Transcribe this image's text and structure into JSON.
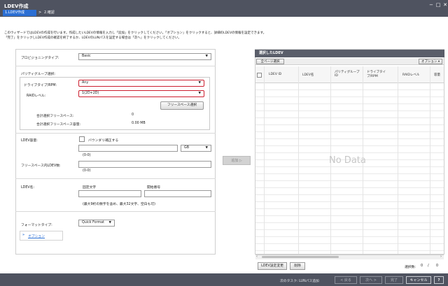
{
  "window": {
    "title": "LDEV作成",
    "minimize_label": "−",
    "maximize_label": "□",
    "close_label": "✕",
    "steps": [
      "1.LDEV作成",
      "2.確認"
    ],
    "step_separator": ">"
  },
  "instructions": {
    "line1": "このウィザードではLDEVの作成を行います。作成したいLDEVの情報を入力し「追加」をクリックしてください。「オプション」をクリックすると、詳細のLDEVの情報を設定できます。",
    "line2": "「完了」をクリックしLDEV作成の確認を終了するか、LDEVのLUNパスを設定する場合は「次へ」をクリックしてください。"
  },
  "form": {
    "provisioning_type_label": "プロビジョニングタイプ:",
    "provisioning_type_value": "Basic",
    "parity_group_selection_label": "パリティグループ選択:",
    "drive_type_label": "ドライブタイプ/RPM:",
    "drive_type_value": "Any",
    "raid_level_label": "RAIDレベル:",
    "raid_level_value": "1(2D+2D)",
    "free_space_button": "フリースペース選択",
    "total_free_space_label": "合計選択フリースペース:",
    "total_free_space_value": "0",
    "total_free_capacity_label": "合計選択フリースペース容量:",
    "total_free_capacity_value": "0.00 MB",
    "ldev_capacity_label": "LDEV容量:",
    "boundary_correct_label": "バウンダリ補正する",
    "capacity_unit": "GB",
    "capacity_range": "(0-0)",
    "ldev_per_space_label": "フリースペース内LDEV数:",
    "ldev_per_space_range": "(0-0)",
    "ldev_name_label": "LDEV名:",
    "fixed_chars_label": "固定文字",
    "start_number_label": "開始番号",
    "name_hint": "(最大9桁の数字を含め、最大32文字、空白も可)",
    "format_type_label": "フォーマットタイプ:",
    "format_type_value": "Quick Format",
    "options_link": "オプション"
  },
  "add_button": "追加 ▷",
  "selected_ldevs": {
    "title": "選択したLDEV",
    "select_all_pages": "全ページ選択",
    "options_label": "オプション ▾",
    "columns": [
      "LDEV ID",
      "LDEV名",
      "パリティグループID",
      "ドライブタイプ/RPM",
      "RAIDレベル",
      "容量"
    ],
    "empty_text": "No Data",
    "change_settings_button": "LDEV設定変更",
    "delete_button": "削除",
    "selected_count_label": "選択数:",
    "selected_count": "0",
    "total_separator": "/",
    "total_count": "0"
  },
  "footer": {
    "next_task_label": "次のタスク: LUNパス追加",
    "back_button": "< 戻る",
    "next_button": "次へ >",
    "finish_button": "完了",
    "cancel_button": "キャンセル",
    "help_button": "?"
  }
}
